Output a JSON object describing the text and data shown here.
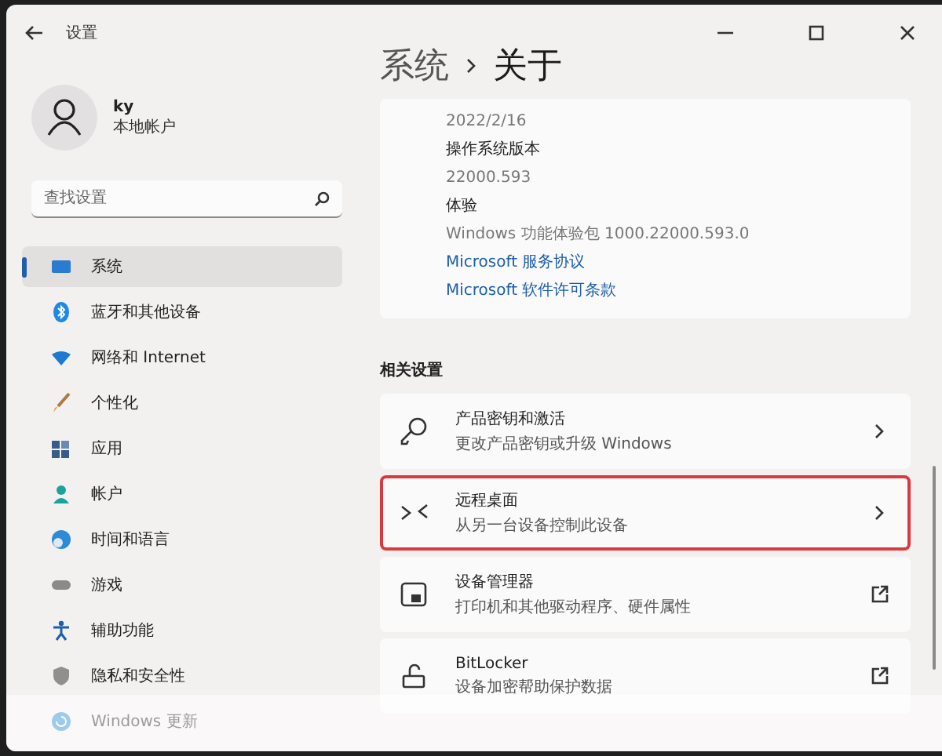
{
  "window": {
    "title": "设置"
  },
  "account": {
    "name": "ky",
    "type": "本地帐户"
  },
  "search": {
    "placeholder": "查找设置"
  },
  "nav": [
    {
      "kind": "system",
      "label": "系统",
      "selected": true
    },
    {
      "kind": "bluetooth",
      "label": "蓝牙和其他设备",
      "selected": false
    },
    {
      "kind": "network",
      "label": "网络和 Internet",
      "selected": false
    },
    {
      "kind": "brush",
      "label": "个性化",
      "selected": false
    },
    {
      "kind": "apps",
      "label": "应用",
      "selected": false
    },
    {
      "kind": "account",
      "label": "帐户",
      "selected": false
    },
    {
      "kind": "time",
      "label": "时间和语言",
      "selected": false
    },
    {
      "kind": "gaming",
      "label": "游戏",
      "selected": false
    },
    {
      "kind": "accessibility",
      "label": "辅助功能",
      "selected": false
    },
    {
      "kind": "privacy",
      "label": "隐私和安全性",
      "selected": false
    },
    {
      "kind": "update",
      "label": "Windows 更新",
      "selected": false
    }
  ],
  "breadcrumb": [
    "系统",
    "关于"
  ],
  "about": [
    {
      "kind": "value",
      "text": "2022/2/16"
    },
    {
      "kind": "label",
      "text": "操作系统版本"
    },
    {
      "kind": "value",
      "text": "22000.593"
    },
    {
      "kind": "label",
      "text": "体验"
    },
    {
      "kind": "value",
      "text": "Windows 功能体验包 1000.22000.593.0"
    },
    {
      "kind": "link",
      "text": "Microsoft 服务协议"
    },
    {
      "kind": "link",
      "text": "Microsoft 软件许可条款"
    }
  ],
  "related": {
    "title": "相关设置",
    "items": [
      {
        "kind": "key",
        "title": "产品密钥和激活",
        "subtitle": "更改产品密钥或升级 Windows",
        "external": false,
        "highlighted": false
      },
      {
        "kind": "remote",
        "title": "远程桌面",
        "subtitle": "从另一台设备控制此设备",
        "external": false,
        "highlighted": true
      },
      {
        "kind": "devices",
        "title": "设备管理器",
        "subtitle": "打印机和其他驱动程序、硬件属性",
        "external": true,
        "highlighted": false
      },
      {
        "kind": "lock",
        "title": "BitLocker",
        "subtitle": "设备加密帮助保护数据",
        "external": true,
        "highlighted": false
      }
    ]
  }
}
